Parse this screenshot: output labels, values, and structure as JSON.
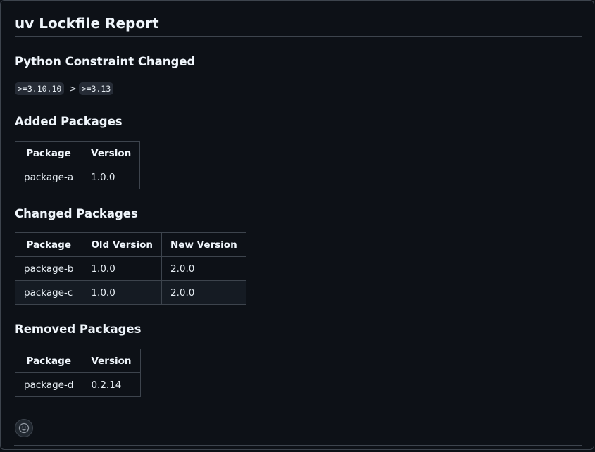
{
  "report": {
    "title": "uv Lockfile Report"
  },
  "python_constraint": {
    "heading": "Python Constraint Changed",
    "old": ">=3.10.10",
    "arrow": "->",
    "new": ">=3.13"
  },
  "added": {
    "heading": "Added Packages",
    "headers": [
      "Package",
      "Version"
    ],
    "rows": [
      [
        "package-a",
        "1.0.0"
      ]
    ]
  },
  "changed": {
    "heading": "Changed Packages",
    "headers": [
      "Package",
      "Old Version",
      "New Version"
    ],
    "rows": [
      [
        "package-b",
        "1.0.0",
        "2.0.0"
      ],
      [
        "package-c",
        "1.0.0",
        "2.0.0"
      ]
    ]
  },
  "removed": {
    "heading": "Removed Packages",
    "headers": [
      "Package",
      "Version"
    ],
    "rows": [
      [
        "package-d",
        "0.2.14"
      ]
    ]
  },
  "reaction": {
    "icon": "smiley-icon"
  }
}
